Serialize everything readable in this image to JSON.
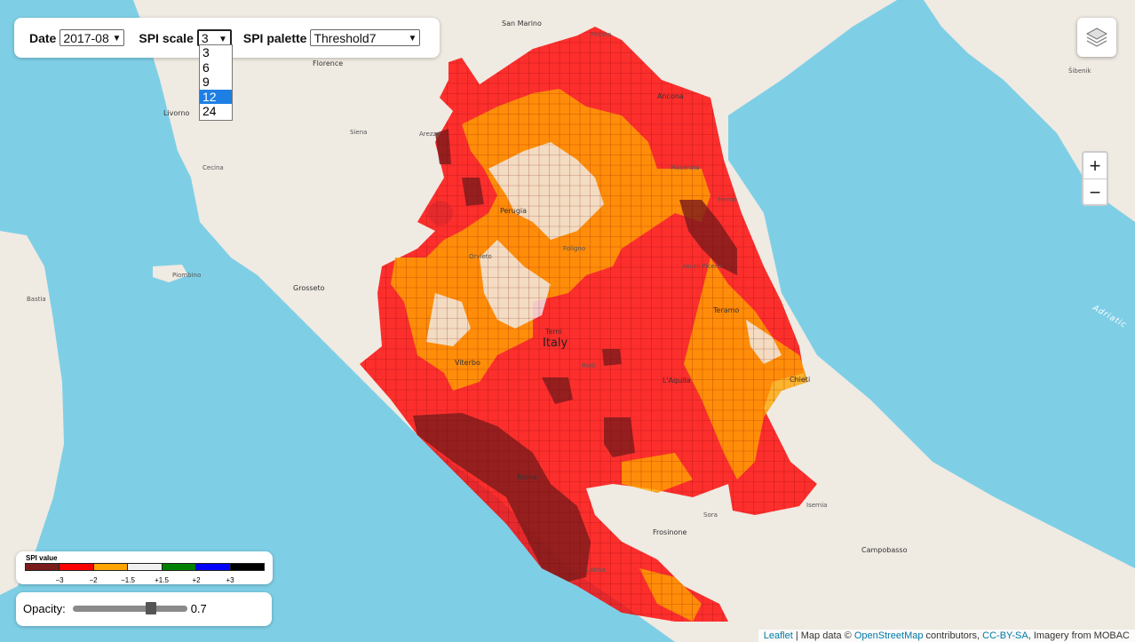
{
  "controls": {
    "date_label": "Date",
    "date_value": "2017-08",
    "scale_label": "SPI scale",
    "scale_value": "3",
    "scale_options": [
      "3",
      "6",
      "9",
      "12",
      "24"
    ],
    "scale_highlighted": "12",
    "palette_label": "SPI palette",
    "palette_value": "Threshold7"
  },
  "zoom": {
    "in": "+",
    "out": "−"
  },
  "legend": {
    "title": "SPI value",
    "colors": [
      "#7a1c1c",
      "#ff0000",
      "#ffa500",
      "#f0f0f0",
      "#008000",
      "#0000ff",
      "#000000"
    ],
    "ticks": [
      "−3",
      "−2",
      "−1.5",
      "+1.5",
      "+2",
      "+3"
    ]
  },
  "opacity": {
    "label": "Opacity:",
    "value": "0.7",
    "level": 0.7
  },
  "attribution": {
    "leaflet": "Leaflet",
    "sep1": " | Map data © ",
    "osm": "OpenStreetMap",
    "mid": " contributors, ",
    "license": "CC-BY-SA",
    "end": ", Imagery from MOBAC"
  },
  "map_labels": {
    "italy": "Italy",
    "san_marino": "San Marino",
    "pesaro": "Pesaro",
    "ancona": "Ancona",
    "florence": "Florence",
    "livorno": "Livorno",
    "arezzo": "Arezzo",
    "perugia": "Perugia",
    "terni": "Terni",
    "viterbo": "Viterbo",
    "grosseto": "Grosseto",
    "rome": "Rome",
    "laquila": "L'Aquila",
    "teramo": "Teramo",
    "chieti": "Chieti",
    "frosinone": "Frosinone",
    "campobasso": "Campobasso",
    "latina": "Latina",
    "bastia": "Bastia",
    "sibenik": "Šibenik",
    "adriatic": "Adriatic",
    "siena": "Siena",
    "cecina": "Cecina",
    "piombino": "Piombino",
    "orvieto": "Orvieto",
    "rieti": "Rieti",
    "foligno": "Foligno",
    "macerata": "Macerata",
    "fermo": "Fermo",
    "ascoli": "Ascoli Piceno",
    "sora": "Sora",
    "isernia": "Isernia"
  }
}
